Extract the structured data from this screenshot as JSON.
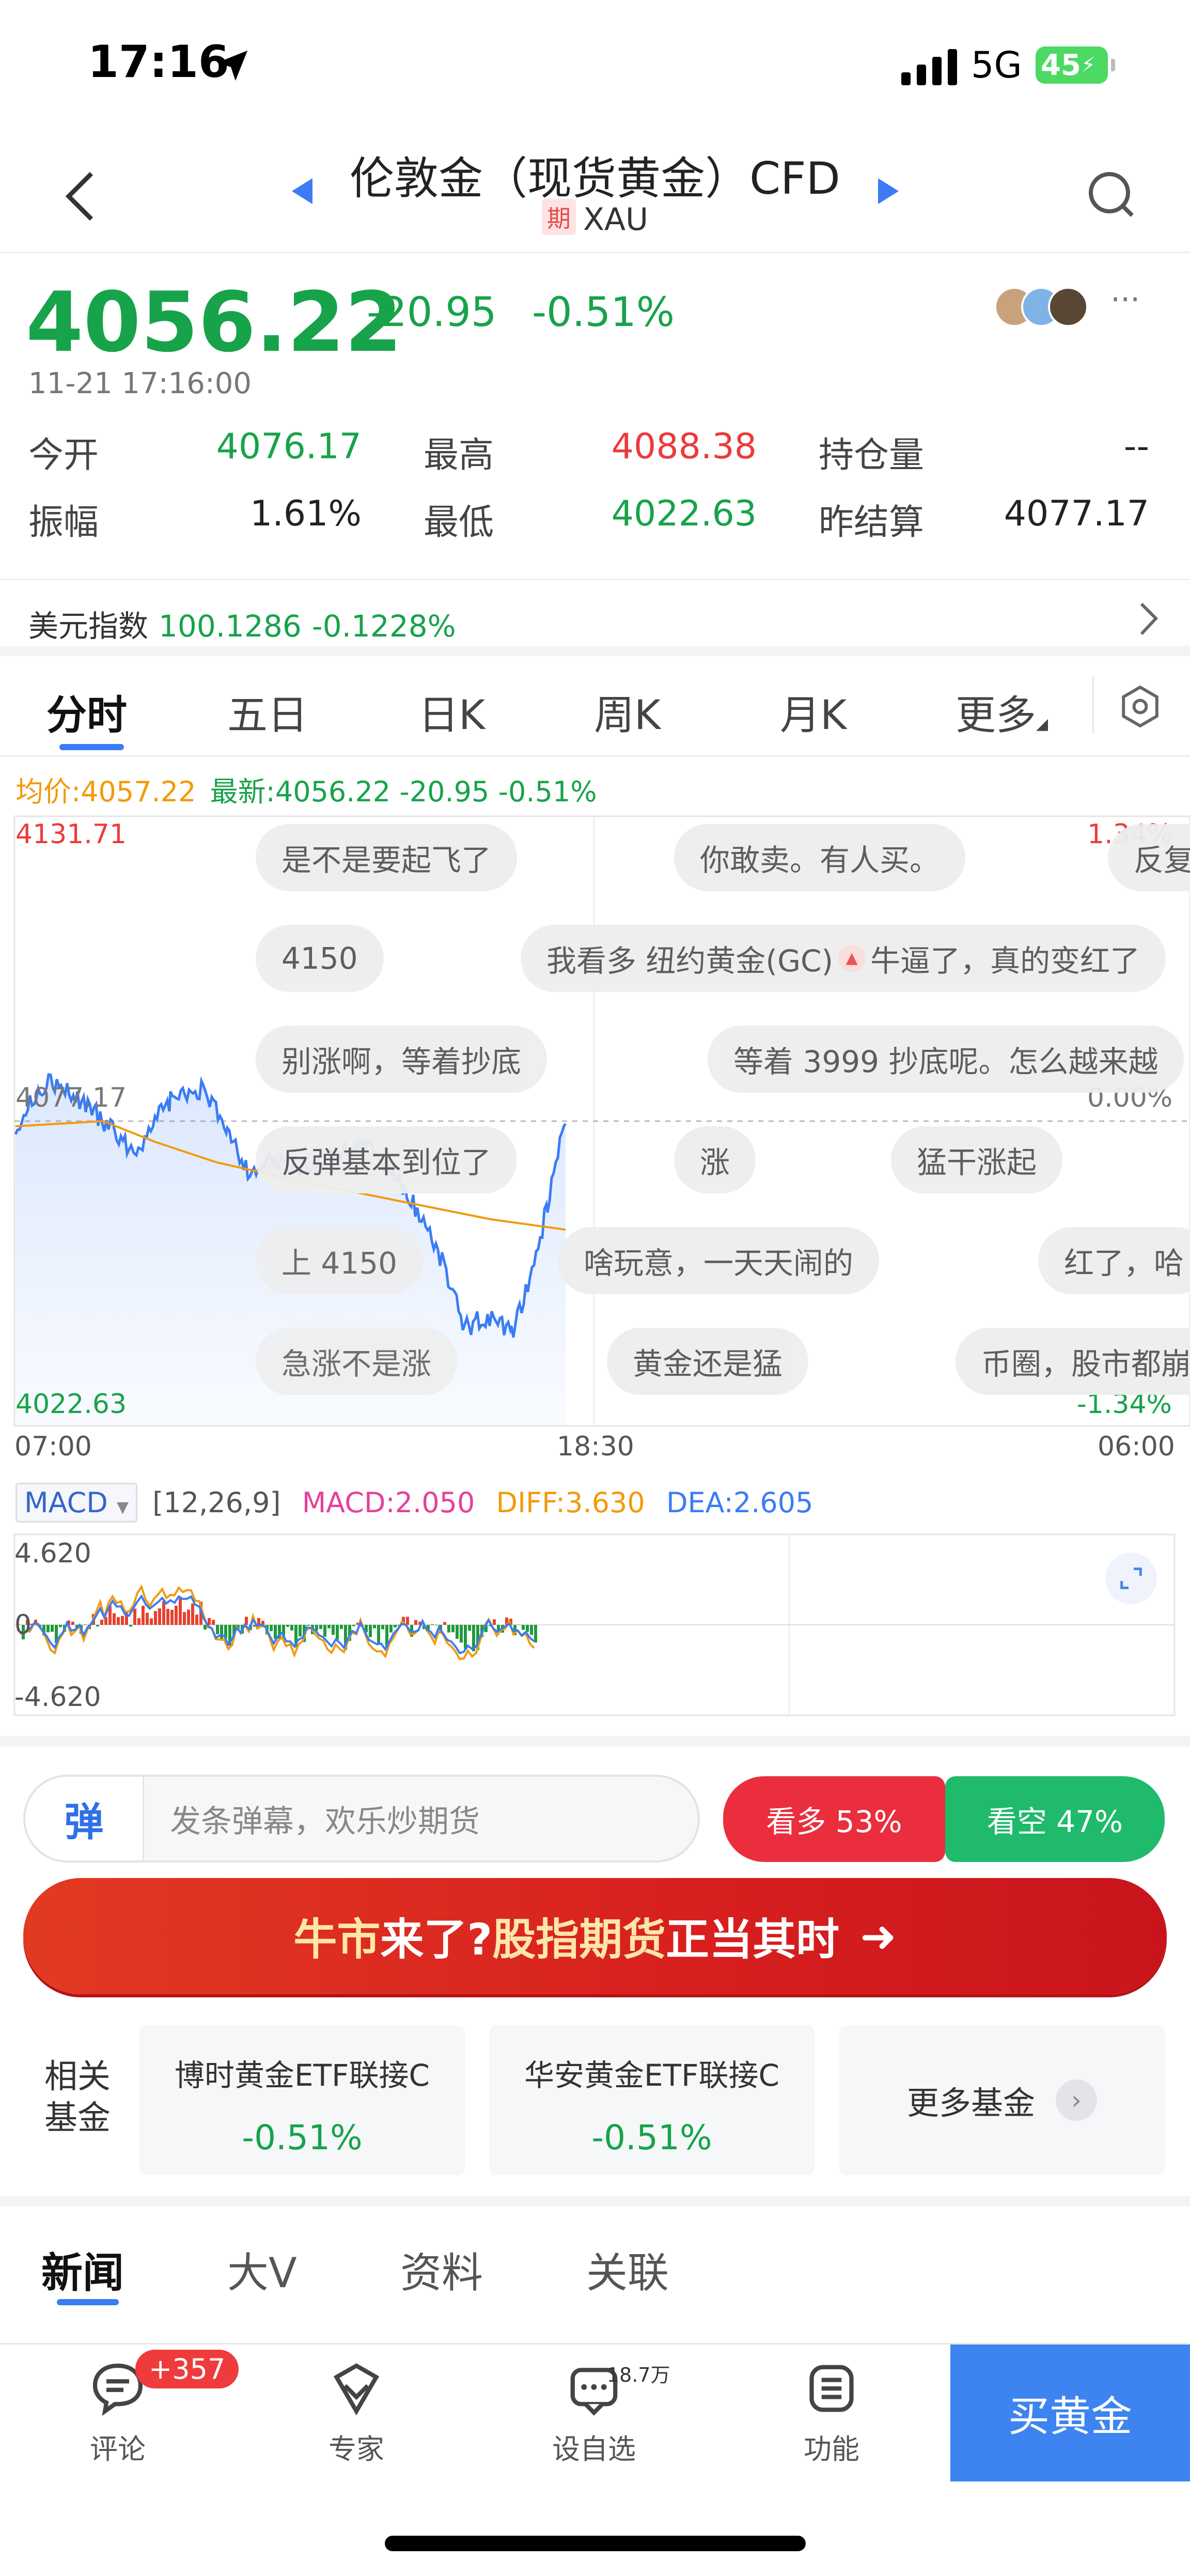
{
  "status": {
    "time": "17:16",
    "network": "5G",
    "battery": "45"
  },
  "header": {
    "title": "伦敦金（现货黄金）CFD",
    "tag": "期",
    "symbol": "XAU"
  },
  "quote": {
    "price": "4056.22",
    "change": "-20.95",
    "change_pct": "-0.51%",
    "timestamp": "11-21 17:16:00",
    "more": "···",
    "stats": {
      "open_label": "今开",
      "open": "4076.17",
      "high_label": "最高",
      "high": "4088.38",
      "oi_label": "持仓量",
      "oi": "--",
      "amp_label": "振幅",
      "amp": "1.61%",
      "low_label": "最低",
      "low": "4022.63",
      "settle_label": "昨结算",
      "settle": "4077.17"
    }
  },
  "dollar_index": {
    "label": "美元指数",
    "value": "100.1286",
    "change": "-0.1228%"
  },
  "tabs": [
    "分时",
    "五日",
    "日K",
    "周K",
    "月K",
    "更多"
  ],
  "info_line": {
    "avg": "均价:4057.22",
    "latest": "最新:4056.22  -20.95  -0.51%"
  },
  "chart_labels": {
    "y_top": "4131.71",
    "y_mid": "4077.17",
    "y_bot": "4022.63",
    "pct_top": "1.34%",
    "pct_mid": "0.00%",
    "pct_bot": "-1.34%",
    "x_start": "07:00",
    "x_mid": "18:30",
    "x_end": "06:00"
  },
  "danmu": [
    "是不是要起飞了",
    "你敢卖。有人买。",
    "反复",
    "4150",
    "我看多 纽约黄金(GC)",
    "牛逼了，真的变红了",
    "别涨啊，等着抄底",
    "等着 3999 抄底呢。怎么越来越",
    "反弹基本到位了",
    "涨",
    "猛干涨起",
    "上 4150",
    "啥玩意，一天天闹的",
    "红了，哈",
    "急涨不是涨",
    "黄金还是猛",
    "币圈，股市都崩"
  ],
  "macd": {
    "selector": "MACD",
    "params": "[12,26,9]",
    "macd": "MACD:2.050",
    "diff": "DIFF:3.630",
    "dea": "DEA:2.605",
    "y_top": "4.620",
    "y_zero": "0",
    "y_bot": "-4.620"
  },
  "danmu_bar": {
    "icon": "弹",
    "placeholder": "发条弹幕，欢乐炒期货",
    "bull": "看多 53%",
    "bear": "看空 47%"
  },
  "banner": {
    "part1": "牛市",
    "part2": "来了?",
    "part3": "股指期货",
    "part4": "正当其时",
    "arrow": "➜"
  },
  "funds": {
    "label_line1": "相关",
    "label_line2": "基金",
    "items": [
      {
        "name": "博时黄金ETF联接C",
        "change": "-0.51%"
      },
      {
        "name": "华安黄金ETF联接C",
        "change": "-0.51%"
      }
    ],
    "more": "更多基金"
  },
  "news_tabs": [
    "新闻",
    "大V",
    "资料",
    "关联"
  ],
  "nav": {
    "comment": "评论",
    "comment_badge": "+357",
    "expert": "专家",
    "watch": "设自选",
    "watch_count": "18.7万",
    "func": "功能",
    "buy": "买黄金"
  },
  "colors": {
    "up": "#ec3b3b",
    "down": "#17a34a",
    "accent": "#3b7cf5",
    "avg_line": "#f29a0b"
  }
}
